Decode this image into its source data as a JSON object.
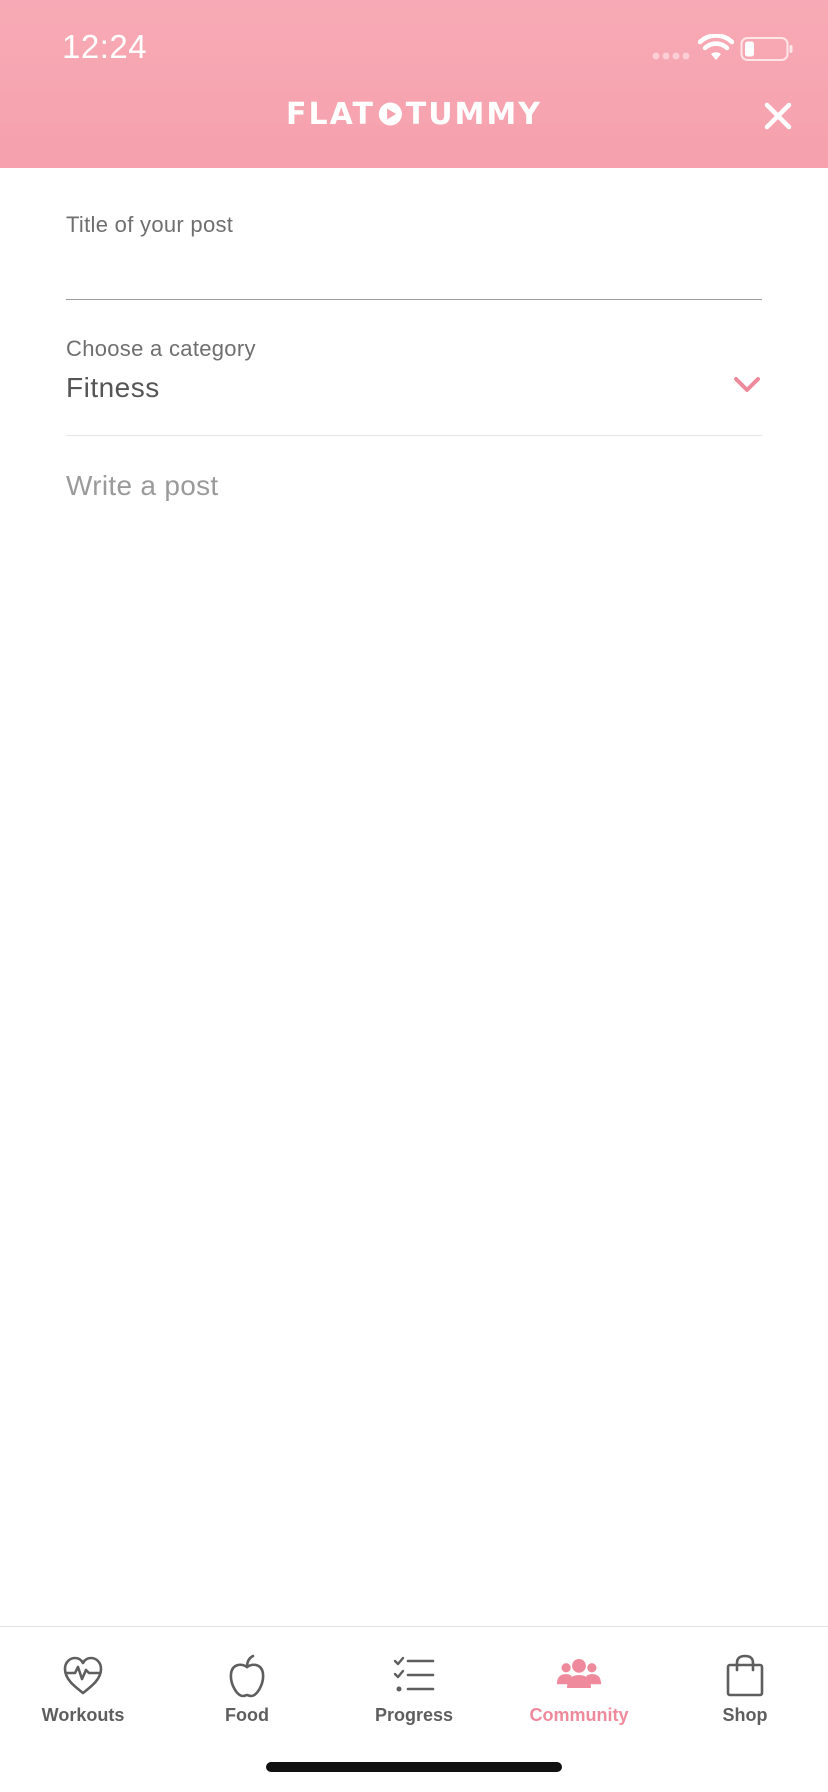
{
  "status_bar": {
    "time": "12:24"
  },
  "header": {
    "logo_left": "FLAT",
    "logo_right": "TUMMY",
    "close_icon": "close-icon"
  },
  "form": {
    "title_label": "Title of your post",
    "title_value": "",
    "category_label": "Choose a category",
    "category_value": "Fitness",
    "post_placeholder": "Write a post",
    "post_value": ""
  },
  "tabs": [
    {
      "label": "Workouts",
      "icon": "heart-pulse-icon",
      "active": false
    },
    {
      "label": "Food",
      "icon": "apple-icon",
      "active": false
    },
    {
      "label": "Progress",
      "icon": "checklist-icon",
      "active": false
    },
    {
      "label": "Community",
      "icon": "community-icon",
      "active": true
    },
    {
      "label": "Shop",
      "icon": "shopping-bag-icon",
      "active": false
    }
  ],
  "colors": {
    "header": "#f6a3af",
    "accent": "#ee8a9c",
    "text": "#555555",
    "muted": "#6f6f6f"
  }
}
